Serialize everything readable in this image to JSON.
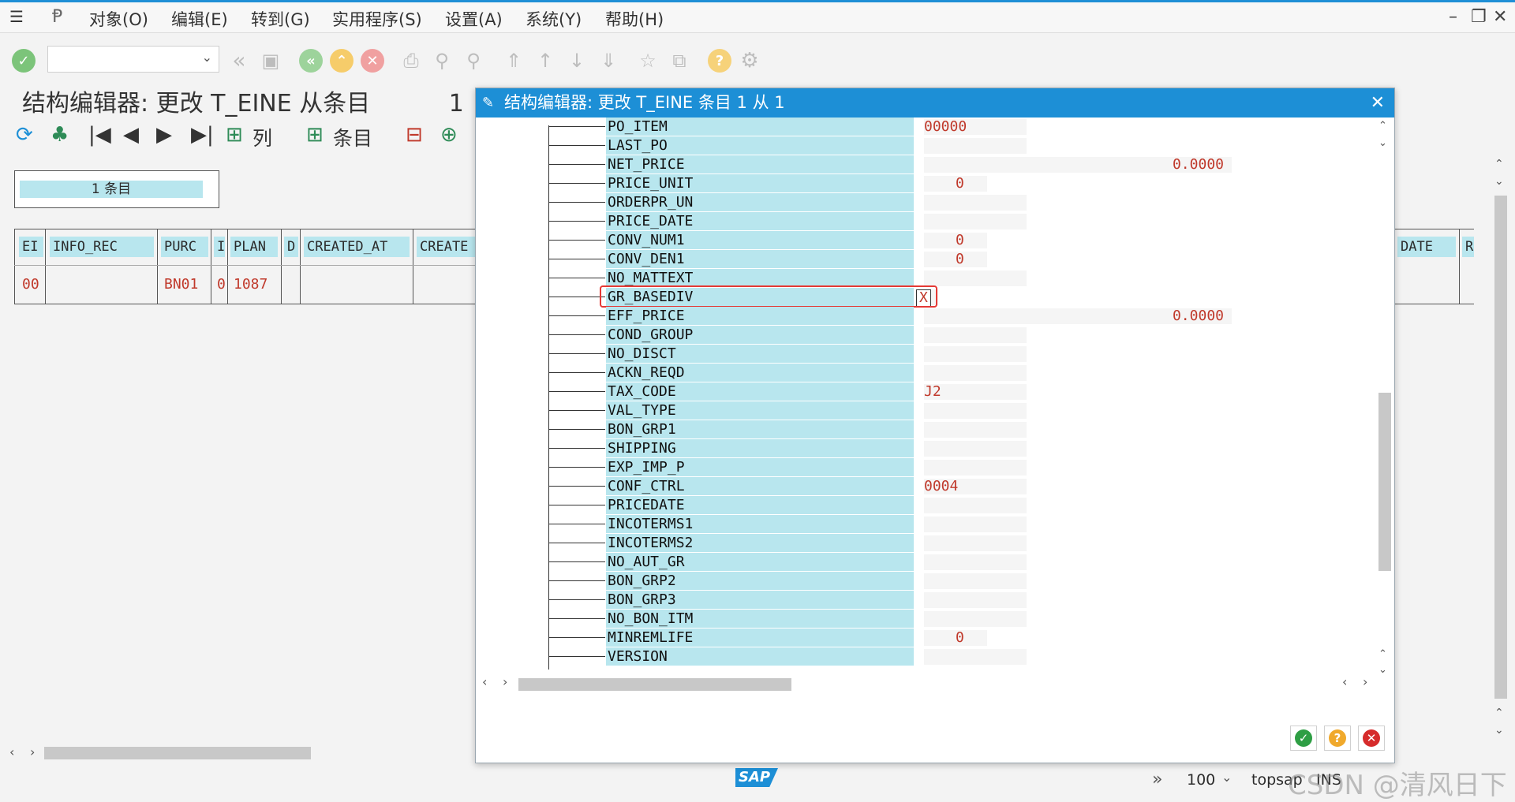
{
  "menu": [
    "对象(O)",
    "编辑(E)",
    "转到(G)",
    "实用程序(S)",
    "设置(A)",
    "系统(Y)",
    "帮助(H)"
  ],
  "background": {
    "title": "结构编辑器: 更改 T_EINE 从条目",
    "title_suffix": "1",
    "toolbar": {
      "col_label": "列",
      "entry_label": "条目"
    },
    "entry_count": "1 条目",
    "grid_headers": [
      "EI",
      "INFO_REC",
      "PURC",
      "I",
      "PLAN",
      "D",
      "CREATED_AT",
      "CREATE",
      "DATE",
      "R"
    ],
    "grid_values": {
      "ei": "00",
      "purch_org": "BN01",
      "i": "0",
      "plant": "1087"
    }
  },
  "dialog": {
    "title": "结构编辑器: 更改 T_EINE 条目 1 从 1",
    "fields": [
      {
        "name": "PO_ITEM",
        "value": "00000",
        "align": "left"
      },
      {
        "name": "LAST_PO",
        "value": ""
      },
      {
        "name": "NET_PRICE",
        "value": "0.0000",
        "align": "right"
      },
      {
        "name": "PRICE_UNIT",
        "value": "0",
        "align": "short"
      },
      {
        "name": "ORDERPR_UN",
        "value": ""
      },
      {
        "name": "PRICE_DATE",
        "value": ""
      },
      {
        "name": "CONV_NUM1",
        "value": "0",
        "align": "short"
      },
      {
        "name": "CONV_DEN1",
        "value": "0",
        "align": "short"
      },
      {
        "name": "NO_MATTEXT",
        "value": ""
      },
      {
        "name": "GR_BASEDIV",
        "value": "X",
        "highlight": true
      },
      {
        "name": "EFF_PRICE",
        "value": "0.0000",
        "align": "right"
      },
      {
        "name": "COND_GROUP",
        "value": ""
      },
      {
        "name": "NO_DISCT",
        "value": ""
      },
      {
        "name": "ACKN_REQD",
        "value": ""
      },
      {
        "name": "TAX_CODE",
        "value": "J2",
        "align": "left"
      },
      {
        "name": "VAL_TYPE",
        "value": ""
      },
      {
        "name": "BON_GRP1",
        "value": ""
      },
      {
        "name": "SHIPPING",
        "value": ""
      },
      {
        "name": "EXP_IMP_P",
        "value": ""
      },
      {
        "name": "CONF_CTRL",
        "value": "0004",
        "align": "left"
      },
      {
        "name": "PRICEDATE",
        "value": ""
      },
      {
        "name": "INCOTERMS1",
        "value": ""
      },
      {
        "name": "INCOTERMS2",
        "value": ""
      },
      {
        "name": "NO_AUT_GR",
        "value": ""
      },
      {
        "name": "BON_GRP2",
        "value": ""
      },
      {
        "name": "BON_GRP3",
        "value": ""
      },
      {
        "name": "NO_BON_ITM",
        "value": ""
      },
      {
        "name": "MINREMLIFE",
        "value": "0",
        "align": "short"
      },
      {
        "name": "VERSION",
        "value": ""
      }
    ]
  },
  "status": {
    "logo": "SAP",
    "zoom": "100",
    "server": "topsap",
    "mode": "INS",
    "watermark": "CSDN @清风日下"
  },
  "colors": {
    "accent": "#1d8fd6",
    "field_bg": "#b8e6ee",
    "value_red": "#c0392b",
    "highlight_border": "#e53935"
  }
}
